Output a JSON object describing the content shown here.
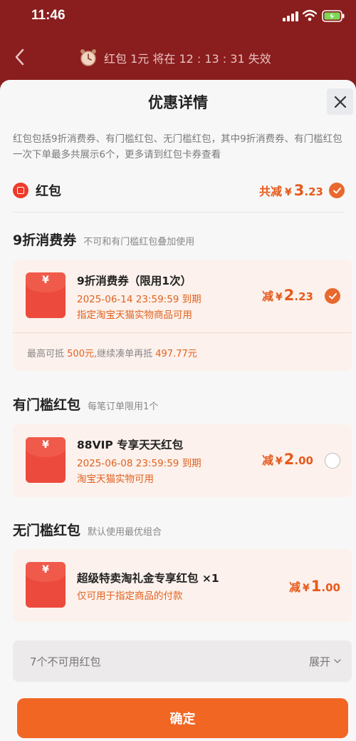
{
  "status": {
    "time": "11:46"
  },
  "nav": {
    "timer_text": "红包 1元 将在 12 : 13 : 31 失效"
  },
  "sheet": {
    "title": "优惠详情",
    "description": "红包包括9折消费券、有门槛红包、无门槛红包，其中9折消费券、有门槛红包一次下单最多共展示6个，更多请到红包卡券查看"
  },
  "hongbao": {
    "label": "红包",
    "total_prefix": "共减",
    "currency": "¥",
    "total_int": "3",
    "total_dec": ".23"
  },
  "section_discount": {
    "title": "9折消费券",
    "subtitle": "不可和有门槛红包叠加使用",
    "coupon": {
      "title": "9折消费券（限用1次）",
      "expiry": "2025-06-14 23:59:59 到期",
      "scope": "指定淘宝天猫实物商品可用",
      "amount_prefix": "减",
      "currency": "¥",
      "amount_int": "2",
      "amount_dec": ".23",
      "selected": true
    },
    "footer_1": "最高可抵",
    "footer_amount": "500元",
    "footer_2": ",继续凑单再抵",
    "footer_rest": "497.77元"
  },
  "section_threshold": {
    "title": "有门槛红包",
    "subtitle": "每笔订单限用1个",
    "coupon": {
      "title": "88VIP 专享天天红包",
      "expiry": "2025-06-08 23:59:59 到期",
      "scope": "淘宝天猫实物可用",
      "amount_prefix": "减",
      "currency": "¥",
      "amount_int": "2",
      "amount_dec": ".00",
      "selected": false
    }
  },
  "section_nothreshold": {
    "title": "无门槛红包",
    "subtitle": "默认使用最优组合",
    "coupon": {
      "title": "超级特卖淘礼金专享红包 ×1",
      "scope": "仅可用于指定商品的付款",
      "amount_prefix": "减",
      "currency": "¥",
      "amount_int": "1",
      "amount_dec": ".00"
    }
  },
  "unavailable": {
    "label": "7个不可用红包",
    "expand": "展开"
  },
  "confirm_label": "确定",
  "colors": {
    "accent": "#f26624",
    "price": "#e65a1c",
    "header_bg": "#8a1d1d"
  },
  "icons": [
    "signal-icon",
    "wifi-icon",
    "battery-icon",
    "back-icon",
    "alarm-clock-icon",
    "close-icon",
    "red-envelope-icon",
    "check-icon",
    "chevron-down-icon"
  ]
}
